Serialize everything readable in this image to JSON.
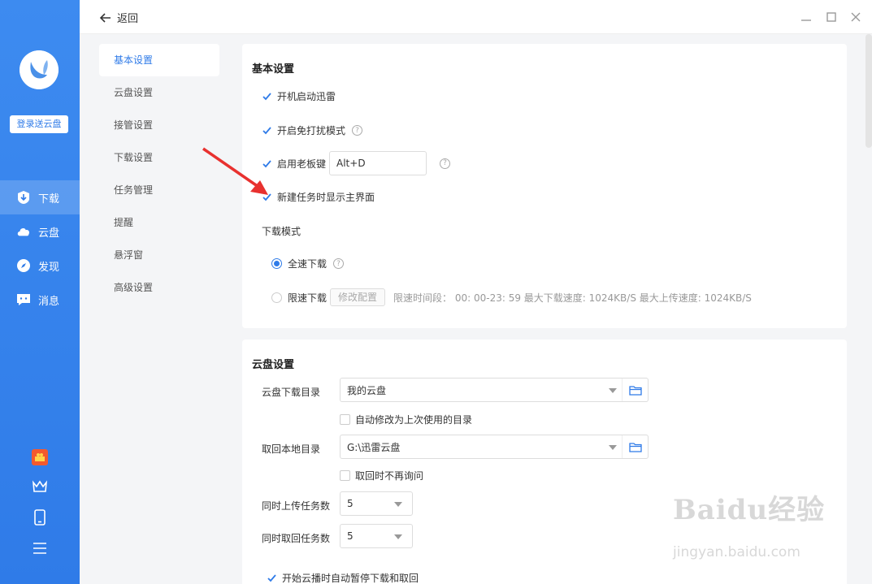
{
  "left_panel": {
    "login_label": "登录送云盘",
    "nav": [
      {
        "label": "下载",
        "icon": "download-icon"
      },
      {
        "label": "云盘",
        "icon": "cloud-icon"
      },
      {
        "label": "发现",
        "icon": "compass-icon"
      },
      {
        "label": "消息",
        "icon": "message-icon"
      }
    ],
    "bottom_icons": [
      "gift-icon",
      "crown-icon",
      "phone-icon",
      "menu-icon"
    ]
  },
  "topbar": {
    "back_label": "返回"
  },
  "sidenav": {
    "items": [
      "基本设置",
      "云盘设置",
      "接管设置",
      "下载设置",
      "任务管理",
      "提醒",
      "悬浮窗",
      "高级设置"
    ]
  },
  "basic": {
    "title": "基本设置",
    "startup": "开机启动迅雷",
    "no_disturb": "开启免打扰模式",
    "boss_key": "启用老板键",
    "boss_key_value": "Alt+D",
    "show_main": "新建任务时显示主界面",
    "mode_title": "下载模式",
    "full_speed": "全速下载",
    "limit_speed": "限速下载",
    "modify_btn": "修改配置",
    "limit_info": "限速时间段： 00: 00-23: 59   最大下载速度: 1024KB/S    最大上传速度: 1024KB/S"
  },
  "cloud": {
    "title": "云盘设置",
    "dl_dir_label": "云盘下载目录",
    "dl_dir_value": "我的云盘",
    "auto_last": "自动修改为上次使用的目录",
    "local_dir_label": "取回本地目录",
    "local_dir_value": "G:\\迅雷云盘",
    "no_ask": "取回时不再询问",
    "upload_label": "同时上传任务数",
    "upload_value": "5",
    "fetch_label": "同时取回任务数",
    "fetch_value": "5",
    "pause_label": "开始云播时自动暂停下载和取回"
  },
  "watermark": {
    "brand": "Baidu经验",
    "url": "jingyan.baidu.com"
  },
  "colors": {
    "accent": "#2f7be8",
    "annotation_arrow": "#e8312f"
  }
}
